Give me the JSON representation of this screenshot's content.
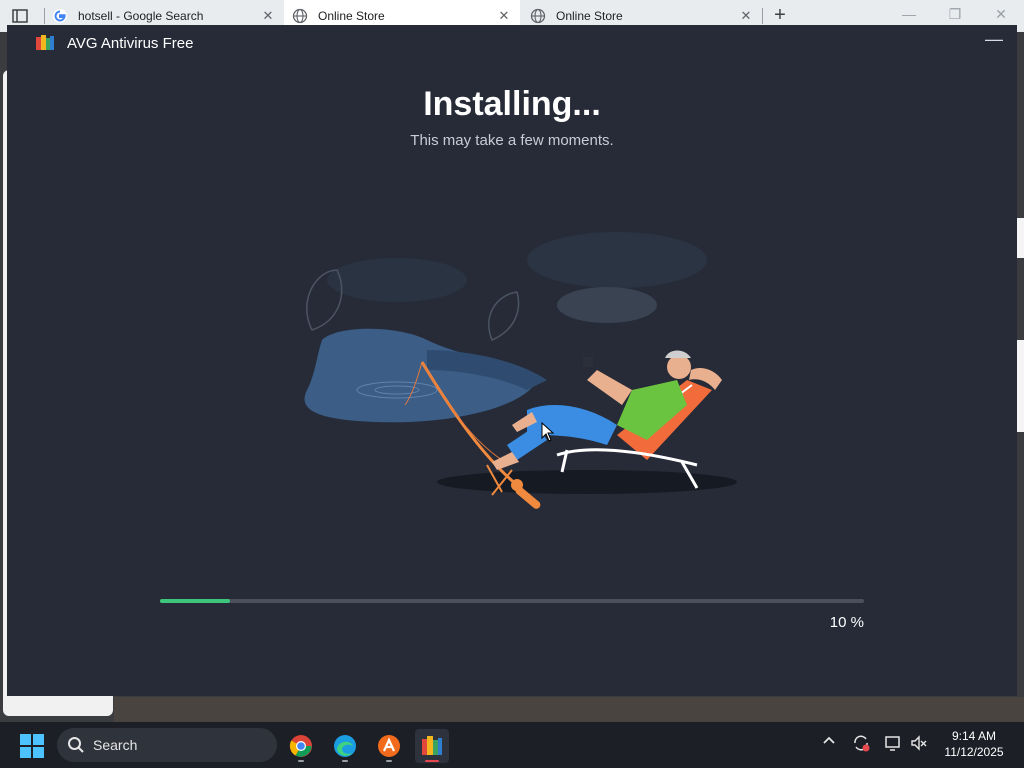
{
  "browser": {
    "tabs": [
      {
        "title": "hotsell - Google Search",
        "icon": "google-g-icon",
        "active": false
      },
      {
        "title": "Online Store",
        "icon": "globe-icon",
        "active": true
      },
      {
        "title": "Online Store",
        "icon": "globe-icon",
        "active": false
      }
    ],
    "close_glyph": "✕",
    "new_tab_glyph": "+"
  },
  "installer": {
    "app_title": "AVG Antivirus Free",
    "minimize_glyph": "—",
    "headline": "Installing...",
    "subtitle": "This may take a few moments.",
    "progress_percent": 10,
    "progress_text": "10 %",
    "illustration": "person-relaxing-fishing-on-beach-chair",
    "colors": {
      "background": "#262b37",
      "progress": "#3cc57b",
      "track": "#4a505e"
    }
  },
  "taskbar": {
    "search_label": "Search",
    "apps": [
      {
        "name": "chrome",
        "icon": "chrome-icon",
        "active": false
      },
      {
        "name": "edge",
        "icon": "edge-icon",
        "active": false
      },
      {
        "name": "avast",
        "icon": "avast-icon",
        "active": false
      },
      {
        "name": "avg",
        "icon": "avg-icon",
        "active": true
      }
    ],
    "tray_icons": [
      "chevron-up-icon",
      "sync-icon",
      "display-icon",
      "speaker-muted-icon"
    ],
    "time": "9:14 AM",
    "date": "11/12/2025"
  }
}
